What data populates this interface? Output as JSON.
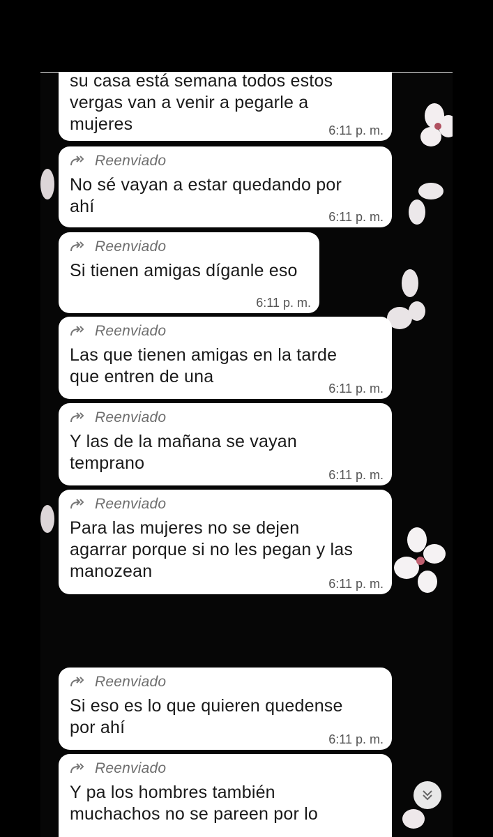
{
  "forwarded_label": "Reenviado",
  "messages": [
    {
      "text": "Un comunicado para todas las\nchicas de aquí no se queden paradas\nen ningún lado vayanse de una a\nsu casa está semana todos estos\nvergas van a venir a pegarle a\nmujeres",
      "time": "6:11 p. m.",
      "forwarded": false
    },
    {
      "text": "No sé vayan a estar quedando por\nahí",
      "time": "6:11 p. m.",
      "forwarded": true
    },
    {
      "text": "Si tienen amigas díganle eso",
      "time": "6:11 p. m.",
      "forwarded": true
    },
    {
      "text": "Las que tienen amigas en la tarde\nque entren de una",
      "time": "6:11 p. m.",
      "forwarded": true
    },
    {
      "text": "Y las de la mañana se vayan\ntemprano",
      "time": "6:11 p. m.",
      "forwarded": true
    },
    {
      "text": "Para las mujeres no se dejen\nagarrar porque si no les pegan y las\nmanozean",
      "time": "6:11 p. m.",
      "forwarded": true
    },
    {
      "text": "Si eso es lo que quieren quedense\npor ahí",
      "time": "6:11 p. m.",
      "forwarded": true
    },
    {
      "text": "Y pa los hombres también\nmuchachos no se pareen por lo",
      "time": "",
      "forwarded": true
    }
  ],
  "icons": {
    "forward": "forward-double-arrow-icon",
    "scroll": "chevron-double-down-icon"
  },
  "colors": {
    "background": "#000000",
    "bubble": "#ffffff",
    "text": "#1a1a1a",
    "meta": "#6e6e6e"
  }
}
